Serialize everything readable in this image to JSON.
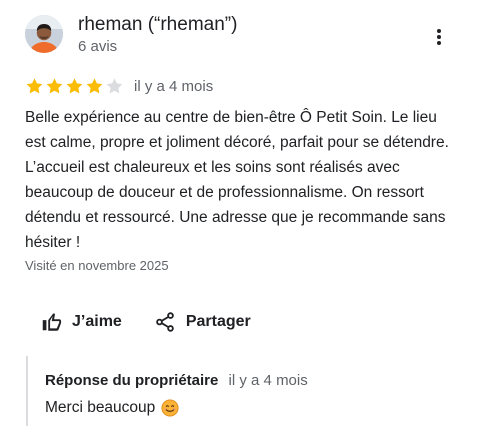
{
  "review": {
    "reviewer": {
      "name": "rheman (“rheman”)",
      "review_count": "6 avis",
      "avatar_icon": "user-avatar"
    },
    "menu_icon": "more-vert-icon",
    "rating": {
      "value": 4,
      "max": 5,
      "filled_color": "#fbbc04",
      "empty_color": "#dadce0",
      "time_ago": "il y a 4 mois"
    },
    "text": "Belle expérience au centre de bien-être Ô Petit Soin. Le lieu est calme, propre et joliment décoré, parfait pour se détendre. L’accueil est chaleureux et les soins sont réalisés avec beaucoup de douceur et de professionnalisme. On ressort détendu et ressourcé. Une adresse que je recommande sans hésiter !",
    "visited": "Visité en novembre 2025",
    "actions": {
      "like_label": "J’aime",
      "like_icon": "thumb-up-icon",
      "share_label": "Partager",
      "share_icon": "share-icon"
    },
    "owner_response": {
      "label": "Réponse du propriétaire",
      "time_ago": "il y a 4 mois",
      "text": "Merci beaucoup",
      "emoji_icon": "smiling-face-emoji-icon"
    }
  }
}
